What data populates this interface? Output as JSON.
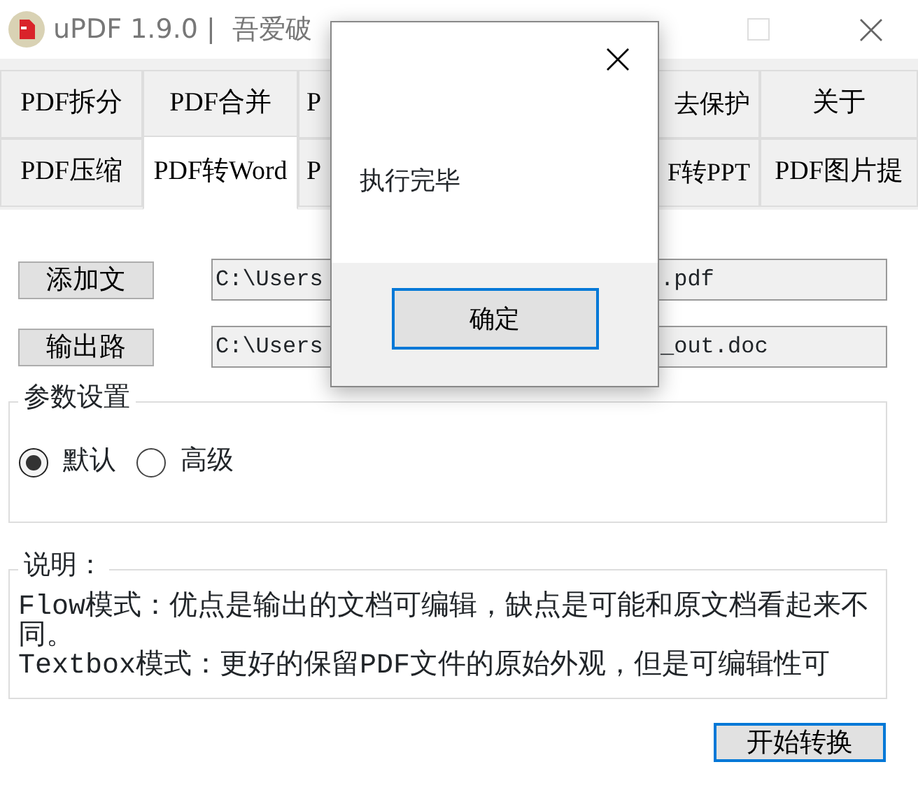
{
  "window": {
    "title": "uPDF 1.9.0 |  吾爱破"
  },
  "tab_rows": [
    [
      {
        "label": "PDF拆分",
        "selected": false
      },
      {
        "label": "PDF合并",
        "selected": false
      },
      {
        "label": "P",
        "selected": false
      },
      {
        "label": "去保护",
        "selected": false
      },
      {
        "label": "关于",
        "selected": false
      }
    ],
    [
      {
        "label": "PDF压缩",
        "selected": false
      },
      {
        "label": "PDF转Word",
        "selected": true
      },
      {
        "label": "P",
        "selected": false
      },
      {
        "label": "F转PPT",
        "selected": false
      },
      {
        "label": "PDF图片提",
        "selected": false
      }
    ]
  ],
  "file_rows": [
    {
      "button": "添加文",
      "value_start": "C:\\Users",
      "value_end": ".pdf"
    },
    {
      "button": "输出路",
      "value_start": "C:\\Users",
      "value_end": "_out.doc"
    }
  ],
  "settings": {
    "title": "参数设置",
    "options": [
      {
        "label": "默认",
        "selected": true
      },
      {
        "label": "高级",
        "selected": false
      }
    ]
  },
  "description": {
    "title": "说明：",
    "lines": [
      "Flow模式：优点是输出的文档可编辑，缺点是可能和原文档看起来不同。",
      "Textbox模式：更好的保留PDF文件的原始外观，但是可编辑性可"
    ]
  },
  "start_button": "开始转换",
  "dialog": {
    "message": "执行完毕",
    "button": "确定"
  }
}
